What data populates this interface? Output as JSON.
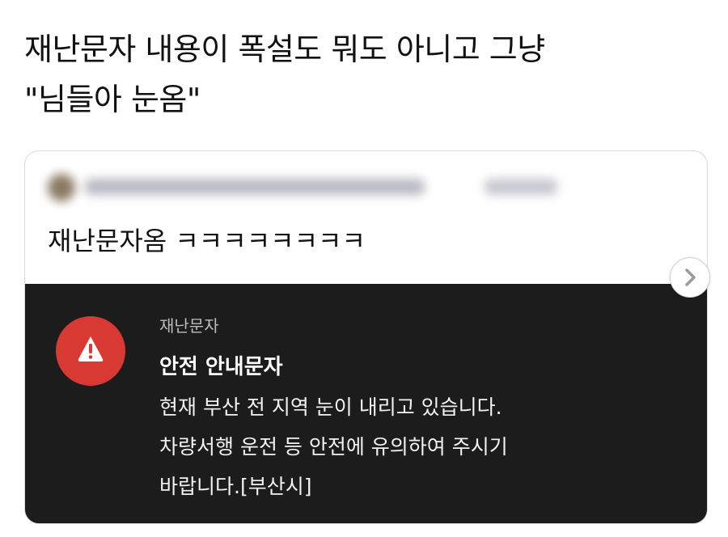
{
  "headline": {
    "line1": "재난문자 내용이 폭설도 뭐도 아니고 그냥",
    "line2": "\"님들아 눈옴\""
  },
  "post": {
    "text": "재난문자옴 ㅋㅋㅋㅋㅋㅋㅋㅋ"
  },
  "alert": {
    "icon": "warning-triangle-icon",
    "icon_color": "#d83a33",
    "background_color": "#1c1c1c",
    "label": "재난문자",
    "title": "안전 안내문자",
    "body_lines": [
      "현재 부산 전 지역 눈이 내리고 있습니다.",
      "차량서행 운전 등 안전에 유의하여 주시기",
      "바랍니다.[부산시]"
    ]
  },
  "carousel": {
    "next_icon": "chevron-right-icon"
  }
}
